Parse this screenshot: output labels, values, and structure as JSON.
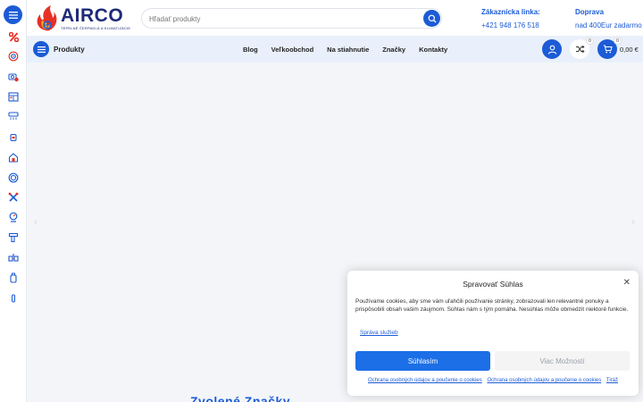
{
  "logo": {
    "name": "AIRCO",
    "tagline": "TEPELNÉ ČERPADLÁ A KLIMATIZÁCIE"
  },
  "search": {
    "placeholder": "Hľadať produkty"
  },
  "hotline": {
    "title": "Zákaznícka linka:",
    "phone": "+421 948 176 518"
  },
  "shipping": {
    "title": "Doprava",
    "note": "nad 400Eur zadarmo"
  },
  "nav": {
    "products_label": "Produkty",
    "links": [
      "Blog",
      "Veľkoobchod",
      "Na stiahnutie",
      "Značky",
      "Kontakty"
    ],
    "compare_count": "0",
    "cart_count": "0",
    "cart_total": "0,00 €"
  },
  "sidebar": {
    "icons": [
      "percent-icon",
      "target-icon",
      "heat-pump-icon",
      "ac-unit-icon",
      "split-ac-icon",
      "tank-icon",
      "solar-house-icon",
      "ring-icon",
      "tools-icon",
      "gauge-icon",
      "pipe-icon",
      "valve-icon",
      "bottle-icon",
      "small-part-icon"
    ]
  },
  "main": {
    "heading_partial": "Zvolené Značky"
  },
  "cookie": {
    "title": "Spravovať Súhlas",
    "close": "✕",
    "text": "Používame cookies, aby sme vám uľahčili používanie stránky, zobrazovali len relevantné ponuky a prispôsobili obsah vašim záujmom. Súhlas nám s tým pomáha. Nesúhlas môže obmedzit niektoré funkcie.",
    "services_link": "Správa služieb",
    "accept": "Súhlasím",
    "more": "Viac Možností",
    "footer_links": [
      "Ochrana osobných údajov a poučenie o cookies",
      "Ochrana osobných údajov a poučenie o cookies",
      "Tiráž"
    ]
  },
  "colors": {
    "primary": "#1c5bd6",
    "accent_red": "#e63027",
    "nav_bg": "#e9f0fb",
    "page_bg": "#f3f5f8"
  }
}
